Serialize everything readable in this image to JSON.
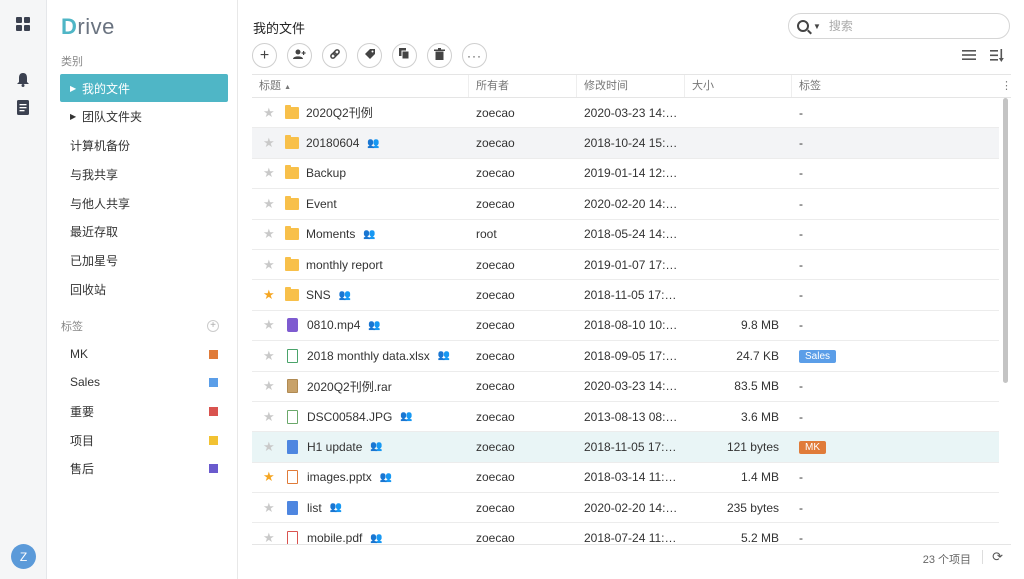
{
  "app": {
    "logo_first": "D",
    "logo_rest": "rive"
  },
  "rail": {
    "avatar_letter": "Z",
    "icons": [
      "apps-icon",
      "bell-icon",
      "document-icon"
    ]
  },
  "sidebar": {
    "category_label": "类别",
    "items": [
      {
        "label": "我的文件",
        "active": true,
        "expandable": true
      },
      {
        "label": "团队文件夹",
        "active": false,
        "expandable": true
      },
      {
        "label": "计算机备份"
      },
      {
        "label": "与我共享"
      },
      {
        "label": "与他人共享"
      },
      {
        "label": "最近存取"
      },
      {
        "label": "已加星号"
      },
      {
        "label": "回收站"
      }
    ],
    "tags_label": "标签",
    "tags": [
      {
        "label": "MK",
        "color": "#e07b39"
      },
      {
        "label": "Sales",
        "color": "#5b9ee8"
      },
      {
        "label": "重要",
        "color": "#d9534f"
      },
      {
        "label": "项目",
        "color": "#f2c232"
      },
      {
        "label": "售后",
        "color": "#6a5acd"
      }
    ]
  },
  "main": {
    "title": "我的文件",
    "search_placeholder": "搜索",
    "columns": [
      "标题",
      "所有者",
      "修改时间",
      "大小",
      "标签"
    ],
    "sort_indicator": "▲",
    "rows": [
      {
        "name": "2020Q2刊例",
        "type": "folder",
        "starred": false,
        "shared": false,
        "owner": "zoecao",
        "modified": "2020-03-23 14:…",
        "size": "",
        "tag": "-"
      },
      {
        "name": "20180604",
        "type": "folder",
        "starred": false,
        "shared": true,
        "owner": "zoecao",
        "modified": "2018-10-24 15:…",
        "size": "",
        "tag": "-"
      },
      {
        "name": "Backup",
        "type": "folder",
        "starred": false,
        "shared": false,
        "owner": "zoecao",
        "modified": "2019-01-14 12:…",
        "size": "",
        "tag": "-"
      },
      {
        "name": "Event",
        "type": "folder",
        "starred": false,
        "shared": false,
        "owner": "zoecao",
        "modified": "2020-02-20 14:…",
        "size": "",
        "tag": "-"
      },
      {
        "name": "Moments",
        "type": "folder",
        "starred": false,
        "shared": true,
        "owner": "root",
        "modified": "2018-05-24 14:…",
        "size": "",
        "tag": "-"
      },
      {
        "name": "monthly report",
        "type": "folder",
        "starred": false,
        "shared": false,
        "owner": "zoecao",
        "modified": "2019-01-07 17:…",
        "size": "",
        "tag": "-"
      },
      {
        "name": "SNS",
        "type": "folder",
        "starred": true,
        "shared": true,
        "owner": "zoecao",
        "modified": "2018-11-05 17:…",
        "size": "",
        "tag": "-"
      },
      {
        "name": "0810.mp4",
        "type": "vid",
        "starred": false,
        "shared": true,
        "owner": "zoecao",
        "modified": "2018-08-10 10:…",
        "size": "9.8 MB",
        "tag": "-"
      },
      {
        "name": "2018 monthly data.xlsx",
        "type": "xls",
        "starred": false,
        "shared": true,
        "owner": "zoecao",
        "modified": "2018-09-05 17:…",
        "size": "24.7 KB",
        "tag": "Sales",
        "tag_color": "#5b9ee8"
      },
      {
        "name": "2020Q2刊例.rar",
        "type": "rar",
        "starred": false,
        "shared": false,
        "owner": "zoecao",
        "modified": "2020-03-23 14:…",
        "size": "83.5 MB",
        "tag": "-"
      },
      {
        "name": "DSC00584.JPG",
        "type": "img",
        "starred": false,
        "shared": true,
        "owner": "zoecao",
        "modified": "2013-08-13 08:…",
        "size": "3.6 MB",
        "tag": "-"
      },
      {
        "name": "H1 update",
        "type": "blue",
        "starred": false,
        "shared": true,
        "owner": "zoecao",
        "modified": "2018-11-05 17:…",
        "size": "121 bytes",
        "tag": "MK",
        "tag_color": "#e07b39"
      },
      {
        "name": "images.pptx",
        "type": "ppt",
        "starred": true,
        "shared": true,
        "owner": "zoecao",
        "modified": "2018-03-14 11:…",
        "size": "1.4 MB",
        "tag": "-"
      },
      {
        "name": "list",
        "type": "blue",
        "starred": false,
        "shared": true,
        "owner": "zoecao",
        "modified": "2020-02-20 14:…",
        "size": "235 bytes",
        "tag": "-"
      },
      {
        "name": "mobile.pdf",
        "type": "pdf",
        "starred": false,
        "shared": true,
        "owner": "zoecao",
        "modified": "2018-07-24 11:…",
        "size": "5.2 MB",
        "tag": "-"
      }
    ],
    "item_count": "23 个项目"
  }
}
